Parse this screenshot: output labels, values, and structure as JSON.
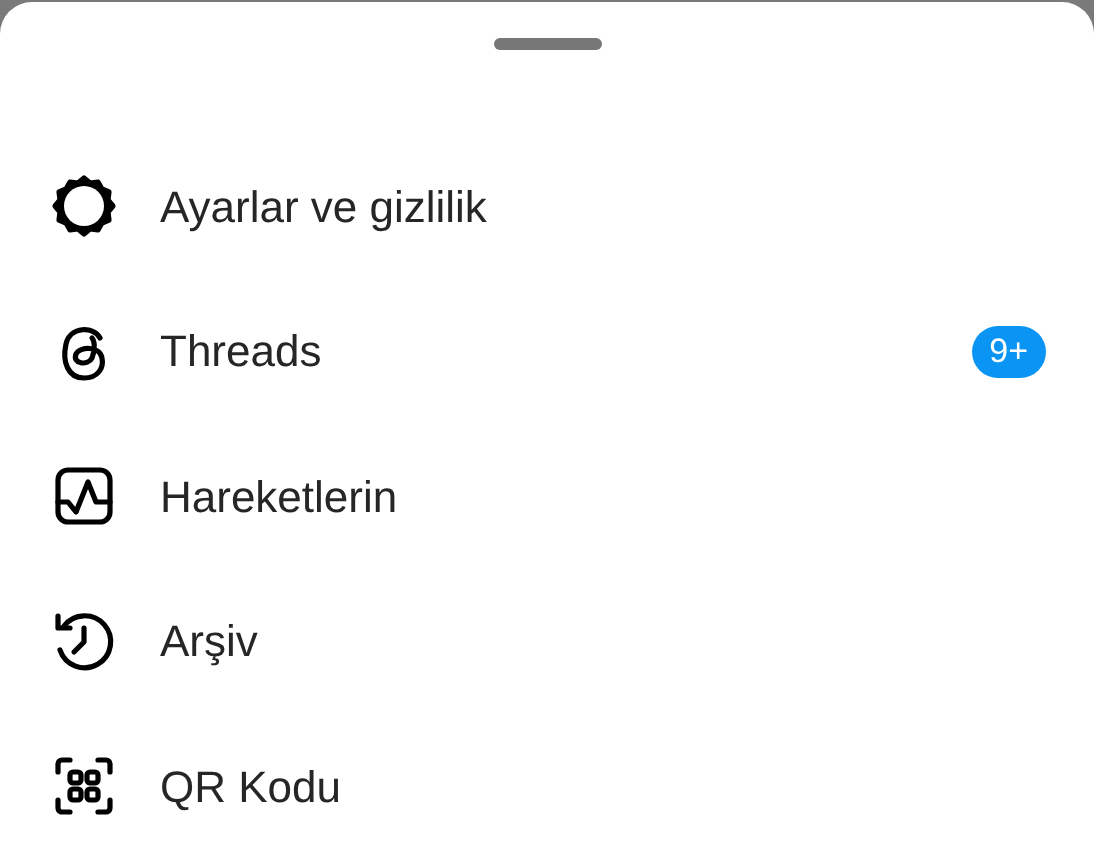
{
  "menu": [
    {
      "label": "Ayarlar ve gizlilik"
    },
    {
      "label": "Threads",
      "badge": "9+"
    },
    {
      "label": "Hareketlerin"
    },
    {
      "label": "Arşiv"
    },
    {
      "label": "QR Kodu"
    }
  ]
}
